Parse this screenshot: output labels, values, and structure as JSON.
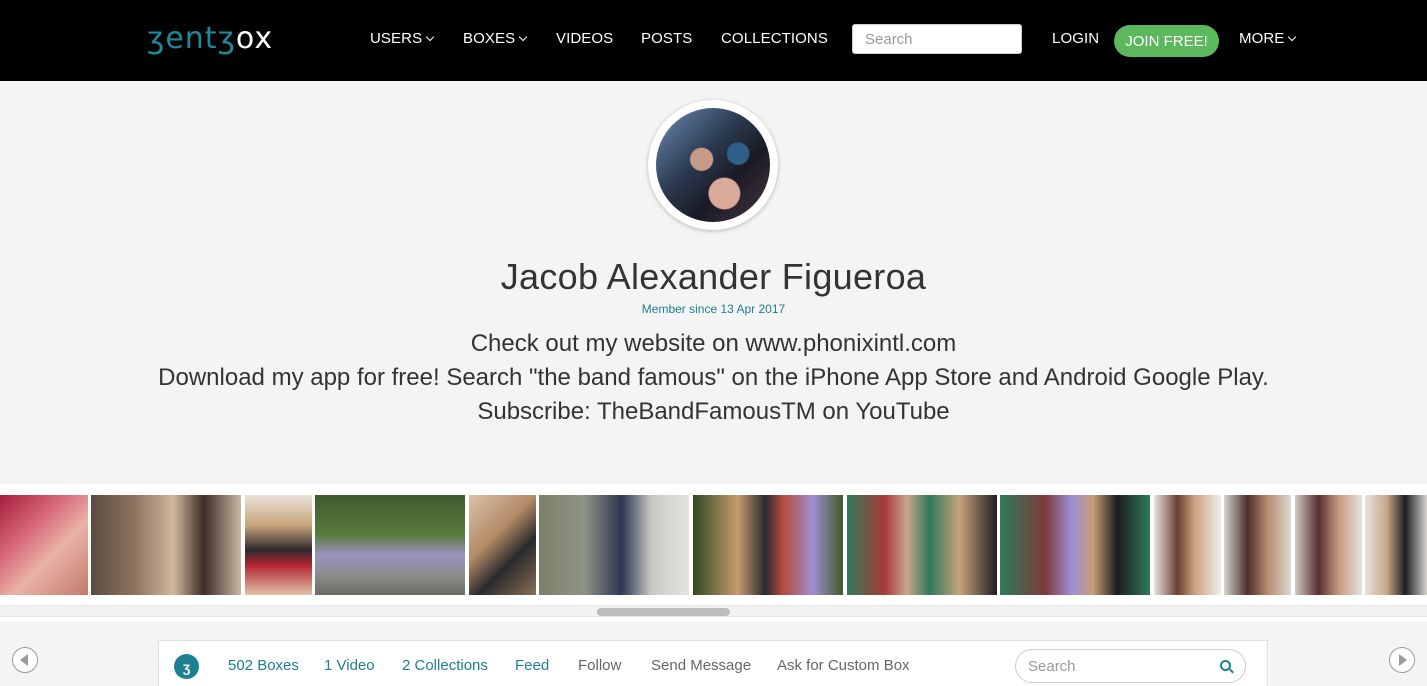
{
  "header": {
    "logo": {
      "part1": "ʒent",
      "part2": "ʒ",
      "part3": "ox"
    },
    "nav": [
      {
        "label": "USERS",
        "dropdown": true
      },
      {
        "label": "BOXES",
        "dropdown": true
      },
      {
        "label": "VIDEOS",
        "dropdown": false
      },
      {
        "label": "POSTS",
        "dropdown": false
      },
      {
        "label": "COLLECTIONS",
        "dropdown": false
      }
    ],
    "search_placeholder": "Search",
    "login_label": "LOGIN",
    "join_label": "JOIN FREE!",
    "more_label": "MORE"
  },
  "profile": {
    "name": "Jacob Alexander Figueroa",
    "member_since": "Member since 13 Apr 2017",
    "bio": [
      "Check out my website on www.phonixintl.com",
      "Download my app for free! Search \"the band famous\" on the iPhone App Store and Android Google Play.",
      "Subscribe: TheBandFamousTM on YouTube"
    ]
  },
  "thumbnails_count": 13,
  "subnav": {
    "icon_glyph": "ʒ",
    "links": [
      {
        "label": "502 Boxes",
        "style": "teal"
      },
      {
        "label": "1 Video",
        "style": "teal"
      },
      {
        "label": "2 Collections",
        "style": "teal"
      },
      {
        "label": "Feed",
        "style": "teal"
      },
      {
        "label": "Follow",
        "style": "gray"
      },
      {
        "label": "Send Message",
        "style": "gray"
      },
      {
        "label": "Ask for Custom Box",
        "style": "gray"
      }
    ],
    "search_placeholder": "Search"
  },
  "colors": {
    "accent": "#1d7f92",
    "join": "#5cb85c",
    "topbar": "#000000"
  }
}
